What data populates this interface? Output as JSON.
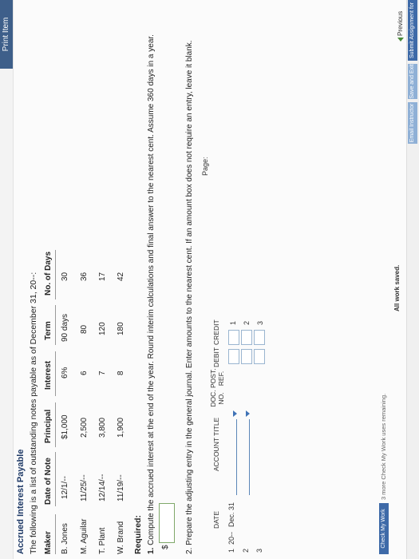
{
  "toolbar": {
    "print_label": "Print Item"
  },
  "title": "Accrued Interest Payable",
  "intro": "The following is a list of outstanding notes payable as of December 31, 20--:",
  "notes_table": {
    "headers": [
      "Maker",
      "Date of Note",
      "Principal",
      "Interest",
      "Term",
      "No. of Days"
    ],
    "rows": [
      [
        "B. Jones",
        "12/1/--",
        "$1,000",
        "6%",
        "90 days",
        "30"
      ],
      [
        "M. Aguilar",
        "11/25/--",
        "2,500",
        "6",
        "80",
        "36"
      ],
      [
        "T. Plant",
        "12/14/--",
        "3,800",
        "7",
        "120",
        "17"
      ],
      [
        "W. Brand",
        "11/19/--",
        "1,900",
        "8",
        "180",
        "42"
      ]
    ]
  },
  "required_label": "Required:",
  "question1": {
    "number": "1.",
    "text": "Compute the accrued interest at the end of the year. Round interim calculations and final answer to the nearest cent. Assume 360 days in a year.",
    "currency": "$",
    "answer": ""
  },
  "question2": {
    "text": "2. Prepare the adjusting entry in the general journal. Enter amounts to the nearest cent. If an amount box does not require an entry, leave it blank."
  },
  "journal": {
    "page_label": "Page:",
    "headers": {
      "date": "DATE",
      "account": "ACCOUNT TITLE",
      "doc": "DOC. NO.",
      "post": "POST. REF.",
      "debit": "DEBIT",
      "credit": "CREDIT"
    },
    "rows": [
      {
        "line": "1",
        "year": "20--",
        "date": "Dec. 31",
        "rline": "1"
      },
      {
        "line": "2",
        "year": "",
        "date": "",
        "rline": "2"
      },
      {
        "line": "3",
        "year": "",
        "date": "",
        "rline": "3"
      }
    ]
  },
  "footer": {
    "check_label": "Check My Work",
    "remaining": "3 more Check My Work uses remaining.",
    "saved": "All work saved.",
    "previous": "Previous",
    "email_label": "Email Instructor",
    "save_exit_label": "Save and Exit",
    "submit_label": "Submit Assignment for Grading"
  },
  "colors": {
    "title": "#1f3a67",
    "accent_button": "#3e6aa8",
    "input_border": "#7fa86a"
  }
}
